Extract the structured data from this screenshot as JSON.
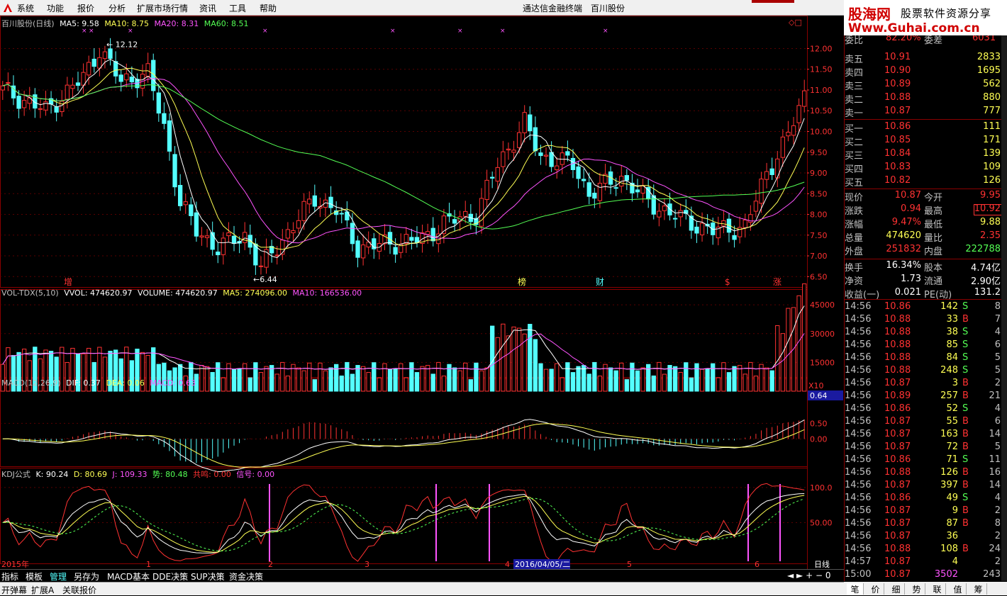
{
  "menu": {
    "items": [
      "系统",
      "功能",
      "报价",
      "分析",
      "扩展市场行情",
      "资讯",
      "工具",
      "帮助"
    ],
    "center_left": "通达信金融终端",
    "center_right": "百川股份"
  },
  "watermark": {
    "line1_a": "股海网",
    "line1_b": "股票软件资源分享",
    "line2": "Www.Guhai.com.cn"
  },
  "main_chart": {
    "title": "百川股份(日线)",
    "ma5": "MA5: 9.58",
    "ma10": "MA10: 8.75",
    "ma20": "MA20: 8.31",
    "ma60": "MA60: 8.51",
    "high_label": "12.12",
    "low_label": "6.44",
    "y_ticks": [
      "12.00",
      "11.50",
      "11.00",
      "10.50",
      "10.00",
      "9.50",
      "9.00",
      "8.50",
      "8.00",
      "7.50",
      "7.00",
      "6.50"
    ],
    "markers": [
      "增",
      "榜",
      "财",
      "$",
      "涨"
    ],
    "colors": {
      "up": "#ff3232",
      "down": "#54ffff",
      "ma5": "#ffffff",
      "ma10": "#ffff54",
      "ma20": "#ff54ff",
      "ma60": "#54ff54"
    }
  },
  "vol_chart": {
    "title": "VOL-TDX(5,10)",
    "vvol": "VVOL: 474620.97",
    "volume": "VOLUME: 474620.97",
    "ma5": "MA5: 274096.00",
    "ma10": "MA10: 166536.00",
    "y_ticks": [
      "45000",
      "30000",
      "15000"
    ],
    "unit": "X10"
  },
  "macd_chart": {
    "title": "MACD(12,26,9)",
    "dif": "DIF: 0.37",
    "dea": "DEA: 0.06",
    "macd": "MACD: 0.63",
    "y_ticks": [
      "0.50",
      "0.00"
    ],
    "current": "0.64"
  },
  "kdj_chart": {
    "title": "KDJ公式",
    "k": "K: 90.24",
    "d": "D: 80.69",
    "j": "J: 109.33",
    "shi": "势: 80.48",
    "gongming": "共鸣: 0.00",
    "xinhao": "信号: 0.00",
    "y_ticks": [
      "100.0",
      "50.00"
    ]
  },
  "x_axis": {
    "labels": [
      "2015年",
      "1",
      "2",
      "3",
      "4",
      "5",
      "6"
    ],
    "cursor": "2016/04/05/二",
    "period": "日线"
  },
  "bottom_tabs": [
    "指标",
    "模板",
    "管理",
    "另存为",
    "MACD基本",
    "DDE决策",
    "SUP决策",
    "资金决策"
  ],
  "bottom_tab_active": "管理",
  "status_bar": [
    "开弹幕",
    "扩展A",
    "关联报价"
  ],
  "quote": {
    "weibi_label": "委比",
    "weibi": "82.20%",
    "weicha_label": "委差",
    "weicha": "6031",
    "asks": [
      {
        "label": "卖五",
        "price": "10.91",
        "vol": "2833"
      },
      {
        "label": "卖四",
        "price": "10.90",
        "vol": "1695"
      },
      {
        "label": "卖三",
        "price": "10.89",
        "vol": "562"
      },
      {
        "label": "卖二",
        "price": "10.88",
        "vol": "880"
      },
      {
        "label": "卖一",
        "price": "10.87",
        "vol": "777"
      }
    ],
    "bids": [
      {
        "label": "买一",
        "price": "10.86",
        "vol": "111"
      },
      {
        "label": "买二",
        "price": "10.85",
        "vol": "171"
      },
      {
        "label": "买三",
        "price": "10.84",
        "vol": "139"
      },
      {
        "label": "买四",
        "price": "10.83",
        "vol": "109"
      },
      {
        "label": "买五",
        "price": "10.82",
        "vol": "126"
      }
    ],
    "stats": [
      {
        "l1": "现价",
        "v1": "10.87",
        "l2": "今开",
        "v2": "9.95",
        "c1": "#ff3232",
        "c2": "#ff3232"
      },
      {
        "l1": "涨跌",
        "v1": "0.94",
        "l2": "最高",
        "v2": "10.92",
        "c1": "#ff3232",
        "c2": "#ff3232"
      },
      {
        "l1": "涨幅",
        "v1": "9.47%",
        "l2": "最低",
        "v2": "9.88",
        "c1": "#ff3232",
        "c2": "#ffff54"
      },
      {
        "l1": "总量",
        "v1": "474620",
        "l2": "量比",
        "v2": "2.35",
        "c1": "#ffff54",
        "c2": "#ff3232"
      },
      {
        "l1": "外盘",
        "v1": "251832",
        "l2": "内盘",
        "v2": "222788",
        "c1": "#ff3232",
        "c2": "#54ff54"
      }
    ],
    "fin": [
      {
        "l1": "换手",
        "v1": "16.34%",
        "l2": "股本",
        "v2": "4.74亿"
      },
      {
        "l1": "净资",
        "v1": "1.73",
        "l2": "流通",
        "v2": "2.90亿"
      },
      {
        "l1": "收益(一)",
        "v1": "0.021",
        "l2": "PE(动)",
        "v2": "131.2"
      }
    ],
    "ticks": [
      {
        "t": "14:56",
        "p": "10.86",
        "v": "142",
        "bs": "S",
        "n": "8"
      },
      {
        "t": "14:56",
        "p": "10.88",
        "v": "33",
        "bs": "B",
        "n": "7"
      },
      {
        "t": "14:56",
        "p": "10.88",
        "v": "38",
        "bs": "S",
        "n": "4"
      },
      {
        "t": "14:56",
        "p": "10.88",
        "v": "85",
        "bs": "S",
        "n": "6"
      },
      {
        "t": "14:56",
        "p": "10.88",
        "v": "84",
        "bs": "S",
        "n": "5"
      },
      {
        "t": "14:56",
        "p": "10.88",
        "v": "248",
        "bs": "S",
        "n": "5"
      },
      {
        "t": "14:56",
        "p": "10.87",
        "v": "3",
        "bs": "B",
        "n": "2"
      },
      {
        "t": "14:56",
        "p": "10.89",
        "v": "257",
        "bs": "B",
        "n": "21"
      },
      {
        "t": "14:56",
        "p": "10.86",
        "v": "52",
        "bs": "S",
        "n": "4"
      },
      {
        "t": "14:56",
        "p": "10.87",
        "v": "55",
        "bs": "B",
        "n": "6"
      },
      {
        "t": "14:56",
        "p": "10.87",
        "v": "163",
        "bs": "B",
        "n": "14"
      },
      {
        "t": "14:56",
        "p": "10.87",
        "v": "72",
        "bs": "B",
        "n": "5"
      },
      {
        "t": "14:56",
        "p": "10.86",
        "v": "71",
        "bs": "S",
        "n": "11"
      },
      {
        "t": "14:56",
        "p": "10.88",
        "v": "126",
        "bs": "B",
        "n": "16"
      },
      {
        "t": "14:56",
        "p": "10.87",
        "v": "397",
        "bs": "B",
        "n": "14"
      },
      {
        "t": "14:56",
        "p": "10.86",
        "v": "49",
        "bs": "S",
        "n": "4"
      },
      {
        "t": "14:56",
        "p": "10.87",
        "v": "9",
        "bs": "B",
        "n": "2"
      },
      {
        "t": "14:56",
        "p": "10.87",
        "v": "87",
        "bs": "B",
        "n": "8"
      },
      {
        "t": "14:56",
        "p": "10.87",
        "v": "36",
        "bs": "",
        "n": "2"
      },
      {
        "t": "14:56",
        "p": "10.88",
        "v": "108",
        "bs": "B",
        "n": "24"
      },
      {
        "t": "14:57",
        "p": "10.87",
        "v": "4",
        "bs": "",
        "n": "2"
      },
      {
        "t": "15:00",
        "p": "10.87",
        "v": "3502",
        "bs": "",
        "n": "243"
      }
    ]
  },
  "right_bottom_tabs": [
    "笔",
    "价",
    "细",
    "势",
    "联",
    "值",
    "筹"
  ]
}
